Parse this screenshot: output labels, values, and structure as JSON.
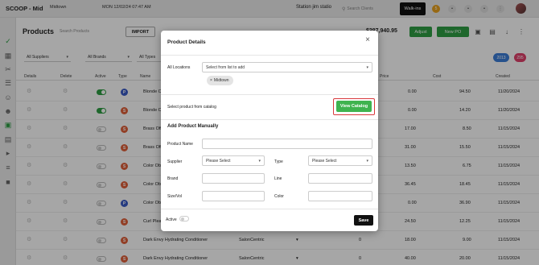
{
  "topbar": {
    "app_title": "SCOOP - Mid",
    "location": "Midtown",
    "datetime": "MON 12/02/24  07:47 AM",
    "station": "Station jim statio",
    "search_placeholder": "Search Clients",
    "walkin_label": "Walk-ins",
    "badge_count": "5"
  },
  "toolbar": {
    "page_title": "Products",
    "search_placeholder": "Search Products",
    "import_label": "IMPORT",
    "total_value": "$397,940.95",
    "adjust_label": "Adjust",
    "new_po_label": "New PO"
  },
  "filters": {
    "suppliers": "All Suppliers",
    "brands": "All Brands",
    "types": "All Types",
    "count_a": "2013",
    "count_b": "295",
    "count_a_color": "#3b7dd8",
    "count_b_color": "#e0406a"
  },
  "table": {
    "headers": [
      "Details",
      "Delete",
      "Active",
      "Type",
      "Name",
      "Price",
      "Cost",
      "Created"
    ],
    "rows": [
      {
        "active": true,
        "type": "P",
        "type_color": "#3a5bc7",
        "name": "Blonde O",
        "supplier": "",
        "qty": "",
        "price": "0.00",
        "cost": "94.50",
        "created": "11/20/2024"
      },
      {
        "active": true,
        "type": "S",
        "type_color": "#e0603a",
        "name": "Blonde O",
        "supplier": "",
        "qty": "",
        "price": "0.00",
        "cost": "14.20",
        "created": "11/20/2024"
      },
      {
        "active": false,
        "type": "S",
        "type_color": "#e0603a",
        "name": "Brass Off",
        "supplier": "",
        "qty": "",
        "price": "17.00",
        "cost": "8.50",
        "created": "11/15/2024"
      },
      {
        "active": false,
        "type": "S",
        "type_color": "#e0603a",
        "name": "Brass Off",
        "supplier": "",
        "qty": "",
        "price": "31.00",
        "cost": "15.50",
        "created": "11/15/2024"
      },
      {
        "active": false,
        "type": "S",
        "type_color": "#e0603a",
        "name": "Color Ob",
        "supplier": "",
        "qty": "",
        "price": "13.50",
        "cost": "6.75",
        "created": "11/15/2024"
      },
      {
        "active": false,
        "type": "S",
        "type_color": "#e0603a",
        "name": "Color Ob",
        "supplier": "",
        "qty": "",
        "price": "36.45",
        "cost": "18.45",
        "created": "11/15/2024"
      },
      {
        "active": false,
        "type": "P",
        "type_color": "#3a5bc7",
        "name": "Color Ob",
        "supplier": "",
        "qty": "",
        "price": "0.00",
        "cost": "36.90",
        "created": "11/15/2024"
      },
      {
        "active": false,
        "type": "S",
        "type_color": "#e0603a",
        "name": "Curl Plea",
        "supplier": "",
        "qty": "",
        "price": "24.50",
        "cost": "12.25",
        "created": "11/15/2024"
      },
      {
        "active": false,
        "type": "S",
        "type_color": "#e0603a",
        "name": "Dark Envy Hydrating Conditioner",
        "supplier": "SalonCentric",
        "qty": "0",
        "price": "18.00",
        "cost": "9.00",
        "created": "11/15/2024"
      },
      {
        "active": false,
        "type": "S",
        "type_color": "#e0603a",
        "name": "Dark Envy Hydrating Conditioner",
        "supplier": "SalonCentric",
        "qty": "0",
        "price": "40.00",
        "cost": "20.00",
        "created": "11/15/2024"
      }
    ]
  },
  "modal": {
    "title": "Product Details",
    "all_locations_label": "All Locations",
    "locations_placeholder": "Select from list to add",
    "chip_label": "Midtown",
    "catalog_prompt": "Select product from catalog",
    "view_catalog_label": "View Catalog",
    "manual_title": "Add Product Manually",
    "product_name_label": "Product Name",
    "supplier_label": "Supplier",
    "supplier_value": "Please Select",
    "type_label": "Type",
    "type_value": "Please Select",
    "brand_label": "Brand",
    "line_label": "Line",
    "size_label": "Size/Vol",
    "color_label": "Color",
    "active_label": "Active",
    "save_label": "Save"
  }
}
